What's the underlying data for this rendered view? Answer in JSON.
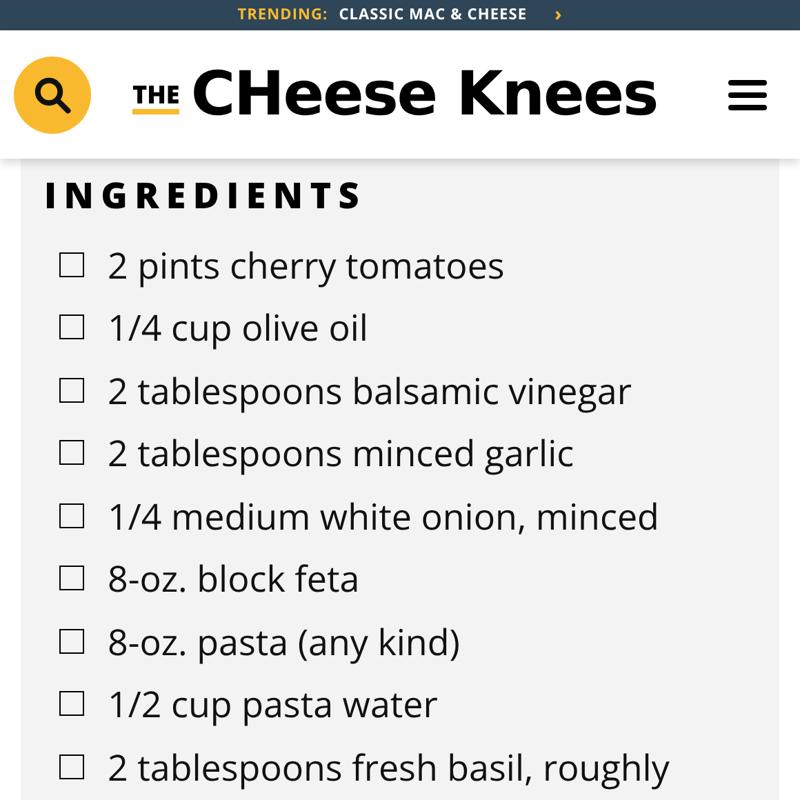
{
  "banner": {
    "label": "TRENDING:",
    "link": "CLASSIC MAC & CHEESE",
    "arrow": "›"
  },
  "header": {
    "logo_small": "THE",
    "logo": "CHeese Knees"
  },
  "ingredients": {
    "title": "INGREDIENTS",
    "items": [
      {
        "text": "2 pints cherry tomatoes",
        "checked": false
      },
      {
        "text": "1/4 cup olive oil",
        "checked": false
      },
      {
        "text": "2 tablespoons balsamic vinegar",
        "checked": false
      },
      {
        "text": "2 tablespoons minced garlic",
        "checked": false
      },
      {
        "text": "1/4 medium white onion, minced",
        "checked": false
      },
      {
        "text": "8-oz. block feta",
        "checked": false
      },
      {
        "text": "8-oz. pasta (any kind)",
        "checked": false
      },
      {
        "text": "1/2 cup pasta water",
        "checked": false
      },
      {
        "text": "2 tablespoons fresh basil, roughly",
        "checked": false
      }
    ]
  }
}
